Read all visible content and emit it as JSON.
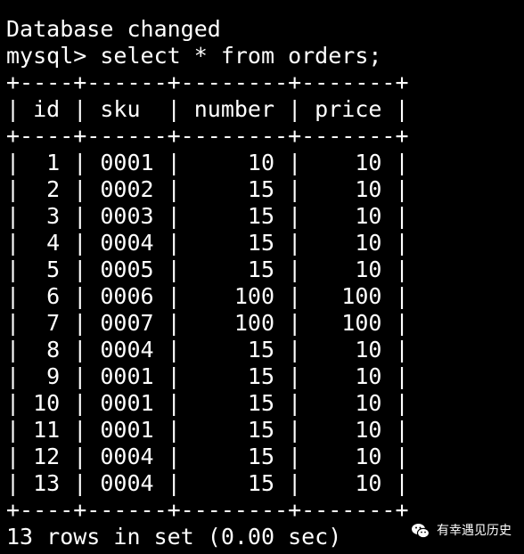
{
  "terminal": {
    "lines": [
      "Database changed",
      "mysql> select * from orders;",
      "+----+------+--------+-------+",
      "| id | sku  | number | price |",
      "+----+------+--------+-------+",
      "|  1 | 0001 |     10 |    10 |",
      "|  2 | 0002 |     15 |    10 |",
      "|  3 | 0003 |     15 |    10 |",
      "|  4 | 0004 |     15 |    10 |",
      "|  5 | 0005 |     15 |    10 |",
      "|  6 | 0006 |    100 |   100 |",
      "|  7 | 0007 |    100 |   100 |",
      "|  8 | 0004 |     15 |    10 |",
      "|  9 | 0001 |     15 |    10 |",
      "| 10 | 0001 |     15 |    10 |",
      "| 11 | 0001 |     15 |    10 |",
      "| 12 | 0004 |     15 |    10 |",
      "| 13 | 0004 |     15 |    10 |",
      "+----+------+--------+-------+",
      "13 rows in set (0.00 sec)"
    ]
  },
  "watermark": {
    "icon": "wechat-icon",
    "text": "有幸遇见历史"
  },
  "colors": {
    "background": "#000000",
    "text": "#ffffff"
  }
}
